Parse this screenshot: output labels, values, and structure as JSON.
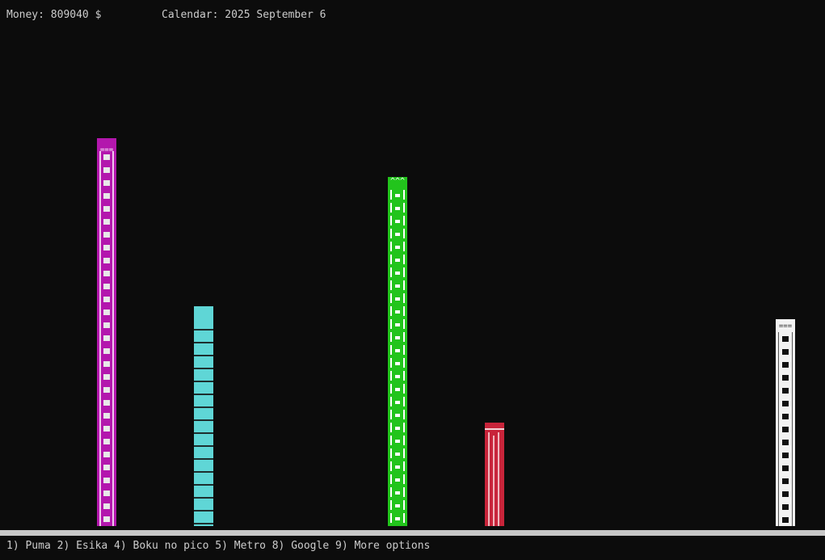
{
  "header": {
    "money": "Money: 809040 $",
    "calendar": "Calendar: 2025 September 6"
  },
  "towers": [
    {
      "name": "Puma",
      "color": "#b317ad",
      "cap": "==="
    },
    {
      "name": "Esika",
      "color": "#5fd6d6",
      "cap": ""
    },
    {
      "name": "Boku no pico",
      "color": "#22c41c",
      "cap": "^^^"
    },
    {
      "name": "Metro",
      "color": "#c8243a",
      "cap": ""
    },
    {
      "name": "Google",
      "color": "#f2f2f2",
      "cap": "==="
    }
  ],
  "menu": {
    "text": "1) Puma 2) Esika 4) Boku no pico 5) Metro 8) Google 9) More options"
  }
}
